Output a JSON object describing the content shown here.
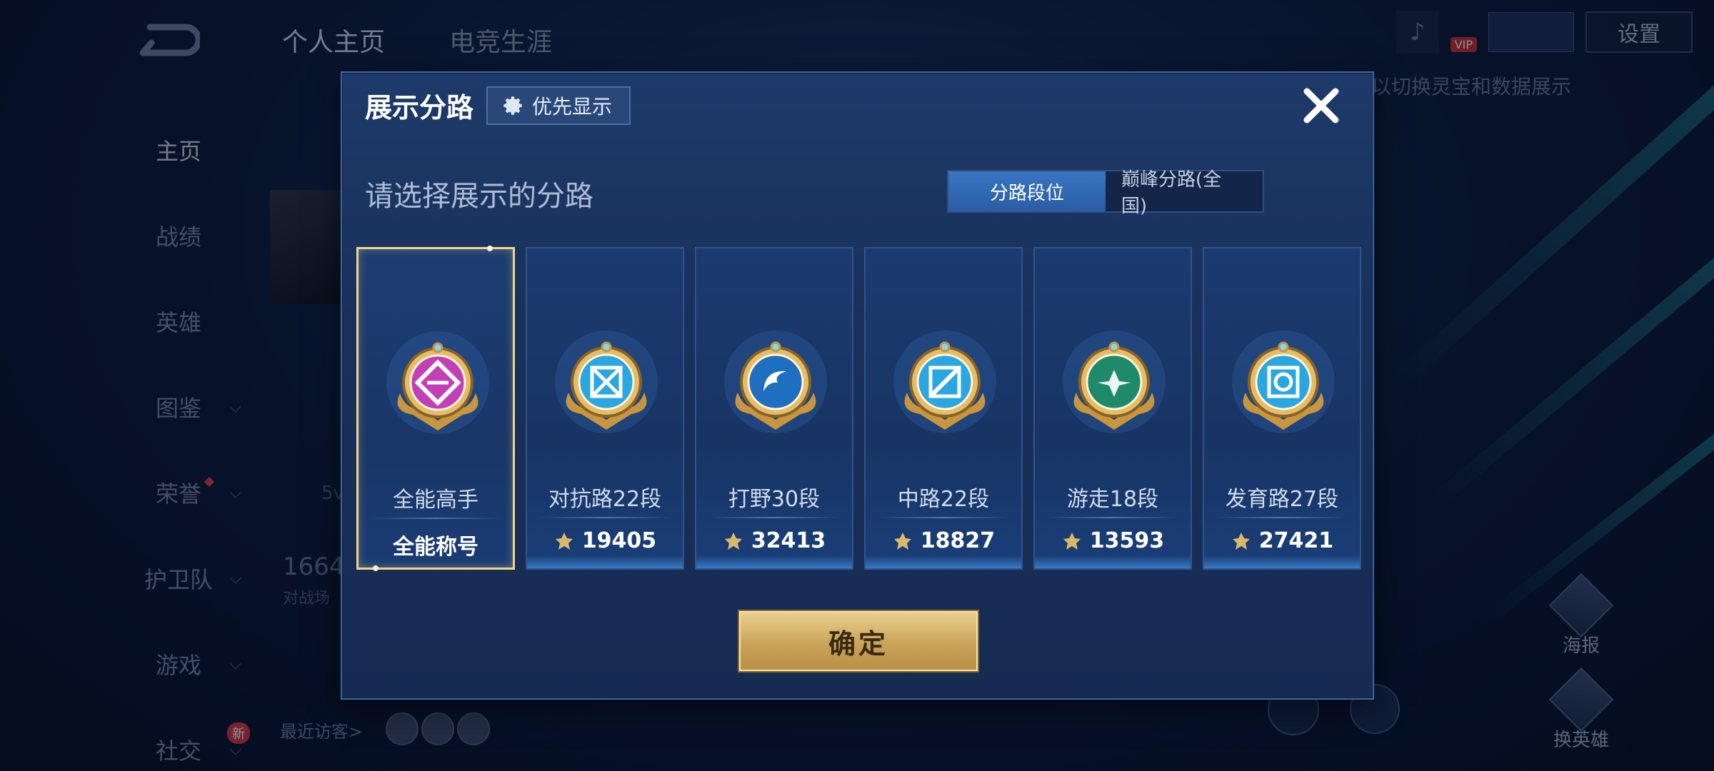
{
  "background": {
    "top_tabs": [
      "个人主页",
      "电竞生涯"
    ],
    "nav": [
      {
        "label": "主页",
        "chevron": false,
        "active": true
      },
      {
        "label": "战绩",
        "chevron": false
      },
      {
        "label": "英雄",
        "chevron": false
      },
      {
        "label": "图鉴",
        "chevron": true
      },
      {
        "label": "荣誉",
        "chevron": true,
        "dot": true
      },
      {
        "label": "护卫队",
        "chevron": true
      },
      {
        "label": "游戏",
        "chevron": true
      },
      {
        "label": "社交",
        "chevron": true,
        "badge": "新"
      }
    ],
    "settings_label": "设置",
    "vip_label": "VIP",
    "hint_text": "以切换灵宝和数据展示",
    "number_text": "1664",
    "number_sub": "对战场",
    "small_text": "5v",
    "visitors_label": "最近访客>",
    "poster_label": "海报",
    "switch_hero_label": "换英雄"
  },
  "modal": {
    "title": "展示分路",
    "priority_label": "优先显示",
    "subtitle": "请选择展示的分路",
    "toggle": {
      "active": "分路段位",
      "inactive": "巅峰分路(全国)"
    },
    "confirm_label": "确定",
    "cards": [
      {
        "name": "全能高手",
        "value": "全能称号",
        "kind": "title",
        "selected": true,
        "medal_color": "#c23fb8"
      },
      {
        "name": "对抗路22段",
        "value": "19405",
        "kind": "score",
        "selected": false,
        "medal_color": "#2aa6e0"
      },
      {
        "name": "打野30段",
        "value": "32413",
        "kind": "score",
        "selected": false,
        "medal_color": "#1f6fc0"
      },
      {
        "name": "中路22段",
        "value": "18827",
        "kind": "score",
        "selected": false,
        "medal_color": "#2aa6e0"
      },
      {
        "name": "游走18段",
        "value": "13593",
        "kind": "score",
        "selected": false,
        "medal_color": "#1f8a6a"
      },
      {
        "name": "发育路27段",
        "value": "27421",
        "kind": "score",
        "selected": false,
        "medal_color": "#2aa6e0"
      }
    ]
  }
}
